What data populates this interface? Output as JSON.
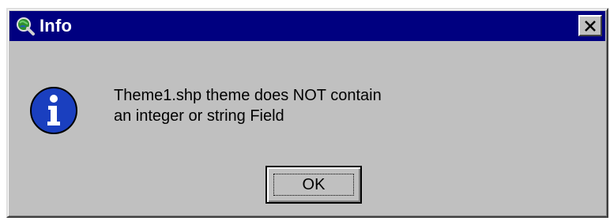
{
  "window": {
    "title": "Info",
    "icon": "globe-magnifier-icon",
    "close_glyph": "✕"
  },
  "dialog": {
    "icon": "information-icon",
    "icon_glyph": "i",
    "message_line1": "Theme1.shp theme does NOT contain",
    "message_line2": "an integer or string Field"
  },
  "buttons": {
    "ok_label": "OK"
  },
  "colors": {
    "titlebar": "#000080",
    "face": "#c0c0c0",
    "info_blue": "#1a3fbf"
  }
}
